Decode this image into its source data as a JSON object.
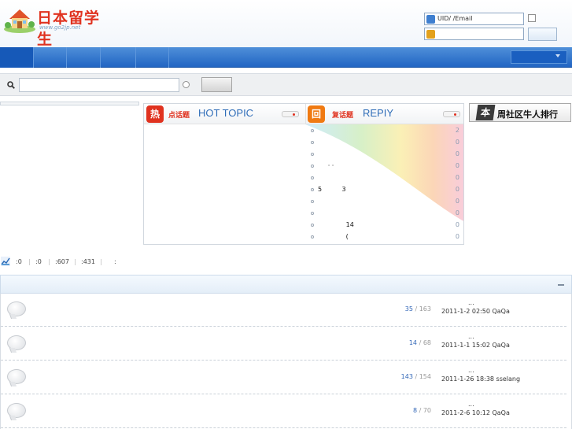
{
  "header": {
    "logo_title": "日本留学生",
    "logo_subtitle": "www.go2jp.net",
    "login": {
      "username_placeholder": "UID/  /Email",
      "password_placeholder": ""
    }
  },
  "search": {
    "input_value": "",
    "button_label": ""
  },
  "hot_topic": {
    "badge": "热",
    "title_cn": "点话题",
    "title_en": "HOT TOPIC"
  },
  "reply": {
    "badge": "回",
    "title_cn": "复话题",
    "title_en": "REPIY",
    "rows": [
      {
        "text": "",
        "count": "2"
      },
      {
        "text": "",
        "count": "0"
      },
      {
        "text": "",
        "count": "0"
      },
      {
        "text": "     · ·",
        "count": "0"
      },
      {
        "text": "",
        "count": "0"
      },
      {
        "text": "5          3",
        "count": "0"
      },
      {
        "text": "",
        "count": "0"
      },
      {
        "text": "",
        "count": "0"
      },
      {
        "text": "              14",
        "count": "0"
      },
      {
        "text": "              (",
        "count": "0"
      }
    ]
  },
  "ranking": {
    "badge": "本",
    "title": "周社区牛人排行"
  },
  "stats": {
    "items": [
      ":0",
      ":0",
      ":607",
      ":431",
      ":"
    ]
  },
  "forums": [
    {
      "replies": "35",
      "views": "163",
      "ellipsis": "...",
      "last_post": "2011-1-2 02:50 QaQa"
    },
    {
      "replies": "14",
      "views": "68",
      "ellipsis": "...",
      "last_post": "2011-1-1 15:02 QaQa"
    },
    {
      "replies": "143",
      "views": "154",
      "ellipsis": "...",
      "last_post": "2011-1-26 18:38 sselang"
    },
    {
      "replies": "8",
      "views": "70",
      "ellipsis": "...",
      "last_post": "2011-2-6 10:12 QaQa"
    }
  ],
  "colors": {
    "nav_blue": "#2165c3",
    "hot_red": "#e0321f",
    "reply_orange": "#f07a12",
    "link_blue": "#3468b8"
  },
  "icons": [
    "house-logo-icon",
    "user-icon",
    "lock-icon",
    "search-icon",
    "stats-chart-icon",
    "chevron-down-icon",
    "forum-bubble-icon",
    "collapse-icon"
  ]
}
